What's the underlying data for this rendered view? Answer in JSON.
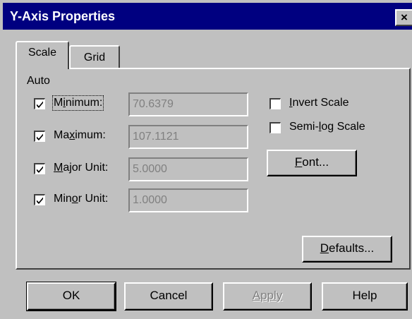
{
  "window": {
    "title": "Y-Axis Properties",
    "close_glyph": "×"
  },
  "tabs": {
    "scale": "Scale",
    "grid": "Grid"
  },
  "auto_label": "Auto",
  "fields": {
    "minimum": {
      "pre": "M",
      "acc": "i",
      "post": "nimum:",
      "value": "70.6379",
      "checked": true
    },
    "maximum": {
      "pre": "Ma",
      "acc": "x",
      "post": "imum:",
      "value": "107.1121",
      "checked": true
    },
    "major_unit": {
      "pre": "",
      "acc": "M",
      "post": "ajor Unit:",
      "value": "5.0000",
      "checked": true
    },
    "minor_unit": {
      "pre": "Min",
      "acc": "o",
      "post": "r Unit:",
      "value": "1.0000",
      "checked": true
    }
  },
  "options": {
    "invert_scale": {
      "pre": "",
      "acc": "I",
      "post": "nvert Scale",
      "checked": false
    },
    "semilog_scale": {
      "pre": "Semi-",
      "acc": "l",
      "post": "og Scale",
      "checked": false
    }
  },
  "buttons": {
    "font": {
      "acc": "F",
      "post": "ont..."
    },
    "defaults": {
      "acc": "D",
      "post": "efaults..."
    },
    "ok": "OK",
    "cancel": "Cancel",
    "apply": "Apply",
    "help": "Help"
  },
  "colors": {
    "titlebar": "#000080",
    "face": "#c0c0c0",
    "disabled_text": "#808080"
  }
}
